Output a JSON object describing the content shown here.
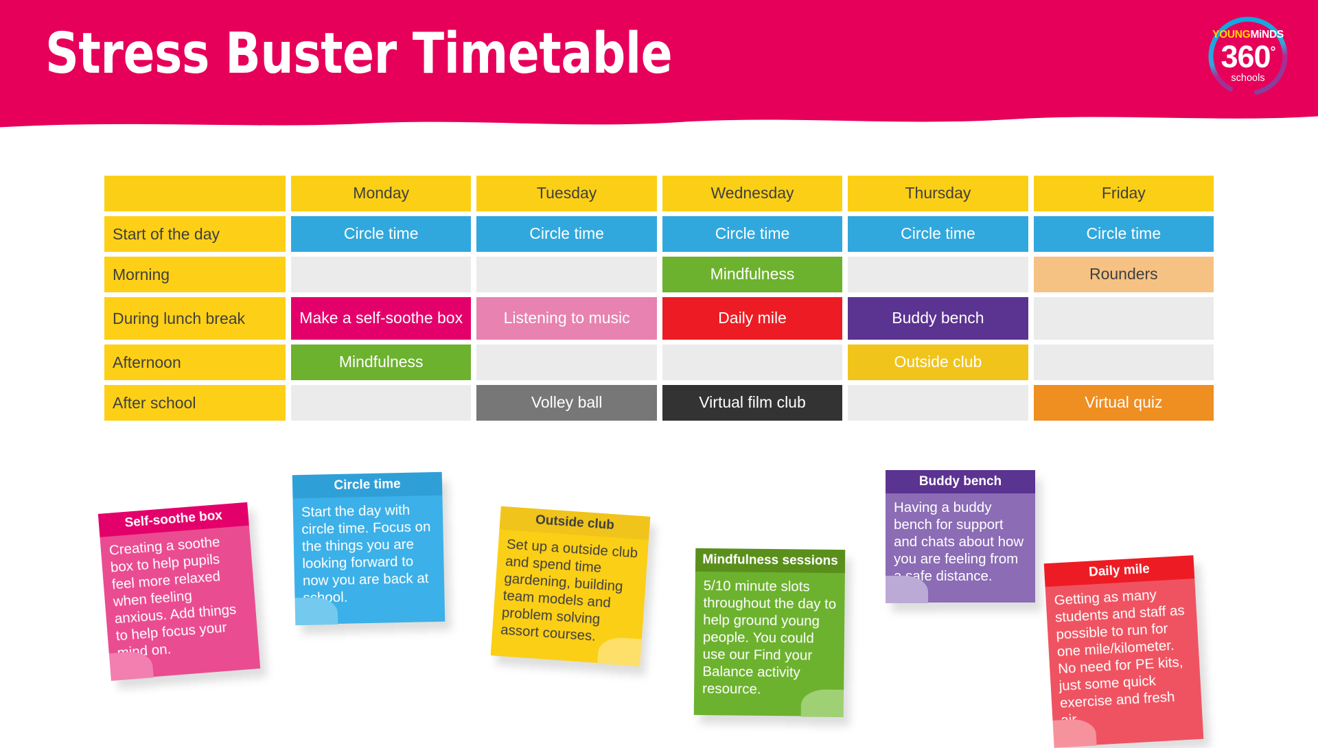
{
  "header": {
    "title": "Stress Buster Timetable",
    "banner_color": "#e6005a",
    "logo": {
      "brand_young": "YOUNG",
      "brand_minds": "MiNDS",
      "number": "360",
      "degree": "°",
      "sub": "schools"
    }
  },
  "timetable": {
    "corner_label": "",
    "days": [
      "Monday",
      "Tuesday",
      "Wednesday",
      "Thursday",
      "Friday"
    ],
    "rows": [
      {
        "label": "Start of the day",
        "cells": [
          {
            "text": "Circle time",
            "color": "#31a8dd",
            "text_color": "#ffffff"
          },
          {
            "text": "Circle time",
            "color": "#31a8dd",
            "text_color": "#ffffff"
          },
          {
            "text": "Circle time",
            "color": "#31a8dd",
            "text_color": "#ffffff"
          },
          {
            "text": "Circle time",
            "color": "#31a8dd",
            "text_color": "#ffffff"
          },
          {
            "text": "Circle time",
            "color": "#31a8dd",
            "text_color": "#ffffff"
          }
        ]
      },
      {
        "label": "Morning",
        "cells": [
          {
            "text": "",
            "color": "#ebebeb",
            "text_color": "#3f3f3f"
          },
          {
            "text": "",
            "color": "#ebebeb",
            "text_color": "#3f3f3f"
          },
          {
            "text": "Mindfulness",
            "color": "#6cb22e",
            "text_color": "#ffffff"
          },
          {
            "text": "",
            "color": "#ebebeb",
            "text_color": "#3f3f3f"
          },
          {
            "text": "Rounders",
            "color": "#f5c283",
            "text_color": "#3f3f3f"
          }
        ]
      },
      {
        "label": "During lunch break",
        "cells": [
          {
            "text": "Make a self-soothe box",
            "color": "#e4006b",
            "text_color": "#ffffff"
          },
          {
            "text": "Listening to music",
            "color": "#e882b0",
            "text_color": "#ffffff"
          },
          {
            "text": "Daily mile",
            "color": "#ed1c24",
            "text_color": "#ffffff"
          },
          {
            "text": "Buddy bench",
            "color": "#5b3391",
            "text_color": "#ffffff"
          },
          {
            "text": "",
            "color": "#ebebeb",
            "text_color": "#3f3f3f"
          }
        ]
      },
      {
        "label": "Afternoon",
        "cells": [
          {
            "text": "Mindfulness",
            "color": "#6cb22e",
            "text_color": "#ffffff"
          },
          {
            "text": "",
            "color": "#ebebeb",
            "text_color": "#3f3f3f"
          },
          {
            "text": "",
            "color": "#ebebeb",
            "text_color": "#3f3f3f"
          },
          {
            "text": "Outside club",
            "color": "#f0c41b",
            "text_color": "#ffffff"
          },
          {
            "text": "",
            "color": "#ebebeb",
            "text_color": "#3f3f3f"
          }
        ]
      },
      {
        "label": "After school",
        "cells": [
          {
            "text": "",
            "color": "#ebebeb",
            "text_color": "#3f3f3f"
          },
          {
            "text": "Volley ball",
            "color": "#777777",
            "text_color": "#ffffff"
          },
          {
            "text": "Virtual film club",
            "color": "#333333",
            "text_color": "#ffffff"
          },
          {
            "text": "",
            "color": "#ebebeb",
            "text_color": "#3f3f3f"
          },
          {
            "text": "Virtual quiz",
            "color": "#ef8e21",
            "text_color": "#ffffff"
          }
        ]
      }
    ]
  },
  "notes": [
    {
      "id": "self-soothe-box",
      "title": "Self-soothe box",
      "body": "Creating a soothe box to help pupils feel more relaxed when feeling anxious. Add things to help focus your mind on.",
      "theme": "pink"
    },
    {
      "id": "circle-time",
      "title": "Circle time",
      "body": "Start the day with circle time. Focus on the things you are looking forward to now you are back at school.",
      "theme": "blue"
    },
    {
      "id": "outside-club",
      "title": "Outside club",
      "body": "Set up a outside club and spend time gardening, building team models and problem solving assort courses.",
      "theme": "yellow"
    },
    {
      "id": "mindfulness-sessions",
      "title": "Mindfulness sessions",
      "body": "5/10 minute slots throughout the day to help ground young people. You could use our Find your Balance activity resource.",
      "theme": "green"
    },
    {
      "id": "buddy-bench",
      "title": "Buddy bench",
      "body": "Having a buddy bench for support and chats about how you are feeling from a safe distance.",
      "theme": "purple"
    },
    {
      "id": "daily-mile",
      "title": "Daily mile",
      "body": "Getting as many students and staff as possible to run for one mile/kilometer. No need for PE kits, just some quick exercise and fresh air.",
      "theme": "red"
    }
  ]
}
